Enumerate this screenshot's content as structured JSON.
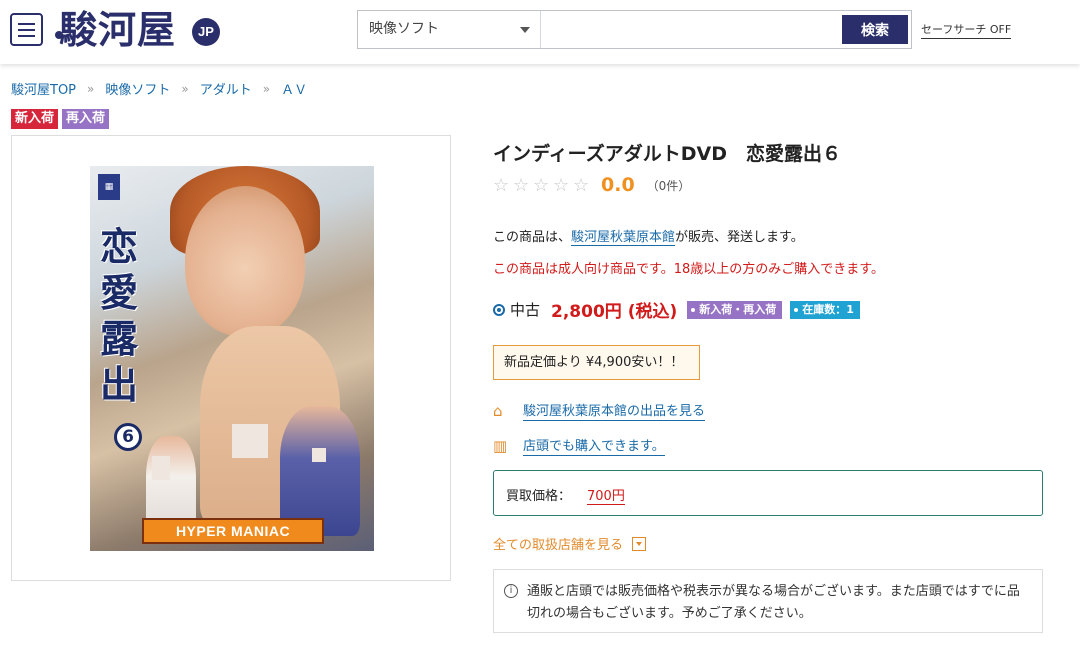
{
  "header": {
    "logo_text": "駿河屋",
    "logo_badge": "JP",
    "search": {
      "category": "映像ソフト",
      "placeholder": "",
      "button_label": "検索"
    },
    "safe_search_label": "セーフサーチ OFF"
  },
  "breadcrumb": [
    "駿河屋TOP",
    "映像ソフト",
    "アダルト",
    "ＡＶ"
  ],
  "breadcrumb_sep": "»",
  "badges": {
    "new": "新入荷",
    "restock": "再入荷"
  },
  "cover": {
    "vertical_title": "恋愛露出",
    "number": "6",
    "series": "HYPER MANIAC"
  },
  "product": {
    "title": "インディーズアダルトDVD　恋愛露出６",
    "rating_value": "0.0",
    "rating_count": "（0件）",
    "seller_prefix": "この商品は、",
    "seller_name": "駿河屋秋葉原本館",
    "seller_suffix": "が販売、発送します。",
    "adult_notice": "この商品は成人向け商品です。18歳以上の方のみご購入できます。",
    "condition": "中古",
    "price": "2,800円 (税込)",
    "tag_restock": "新入荷・再入荷",
    "tag_stock": "在庫数：1",
    "discount_text": "新品定価より ¥4,900安い！！",
    "store_link": "駿河屋秋葉原本館の出品を見る",
    "shop_link": "店頭でも購入できます。",
    "buy_label": "買取価格：",
    "buy_price": "700円",
    "all_stores_label": "全ての取扱店舗を見る",
    "note": "通販と店頭では販売価格や税表示が異なる場合がございます。また店頭ではすでに品切れの場合もございます。予めご了承ください。"
  },
  "colors": {
    "brand": "#2a2f6b",
    "link": "#1a6aa8",
    "price_red": "#d11a1a",
    "accent_orange": "#e28b2c",
    "badge_purple": "#9673c4",
    "badge_red": "#d6263c"
  },
  "icons": [
    "menu-icon",
    "star-icon",
    "store-icon",
    "map-icon",
    "info-icon",
    "caret-down-icon"
  ]
}
